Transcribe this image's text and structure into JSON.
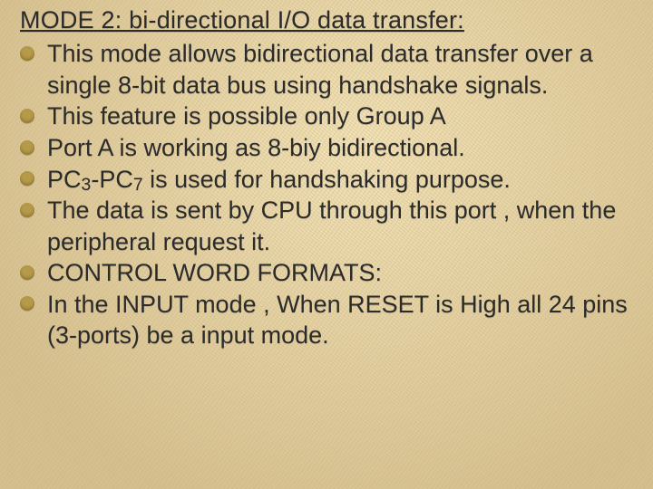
{
  "slide": {
    "title": "MODE 2: bi-directional I/O data transfer:",
    "bullets": [
      {
        "text": "This mode allows bidirectional data transfer over a single 8-bit data bus using handshake signals."
      },
      {
        "text": "This feature is possible only Group A"
      },
      {
        "text": "Port A  is working as 8-biy bidirectional."
      },
      {
        "prefix": "PC",
        "sub1": "3",
        "mid": "-PC",
        "sub2": "7",
        "suffix": " is used for handshaking purpose."
      },
      {
        "text": "The data is sent by CPU through this port , when the peripheral request it."
      },
      {
        "text": "CONTROL WORD FORMATS:"
      },
      {
        "text": "In the INPUT mode , When RESET  is High all 24 pins (3-ports) be a input mode."
      }
    ]
  }
}
